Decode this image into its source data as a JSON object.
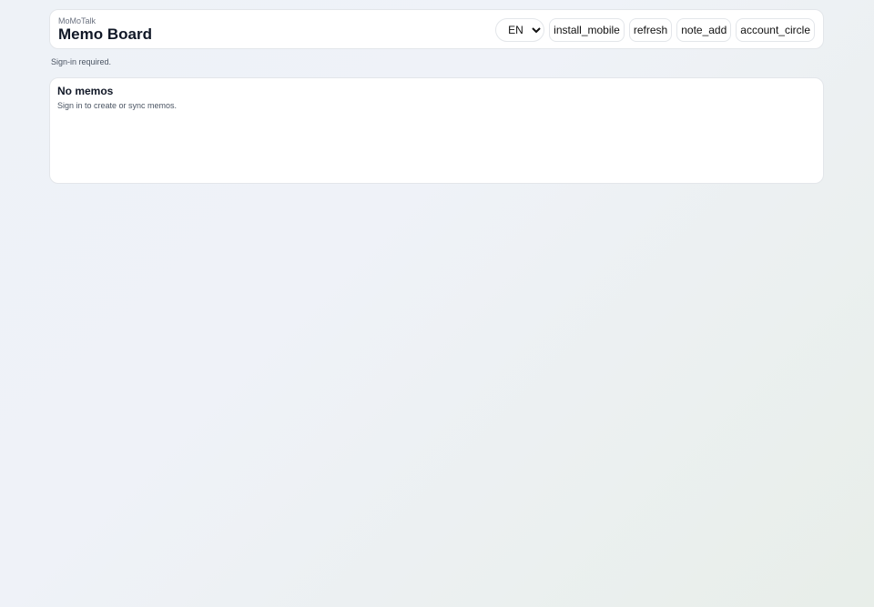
{
  "header": {
    "app_name": "MoMoTalk",
    "title": "Memo Board",
    "language": {
      "selected": "EN",
      "options": [
        "EN"
      ]
    },
    "buttons": {
      "install": "install_mobile",
      "refresh": "refresh",
      "new_memo": "note_add",
      "account": "account_circle"
    }
  },
  "status": {
    "message": "Sign-in required."
  },
  "memos": {
    "empty_title": "No memos",
    "empty_description": "Sign in to create or sync memos."
  }
}
